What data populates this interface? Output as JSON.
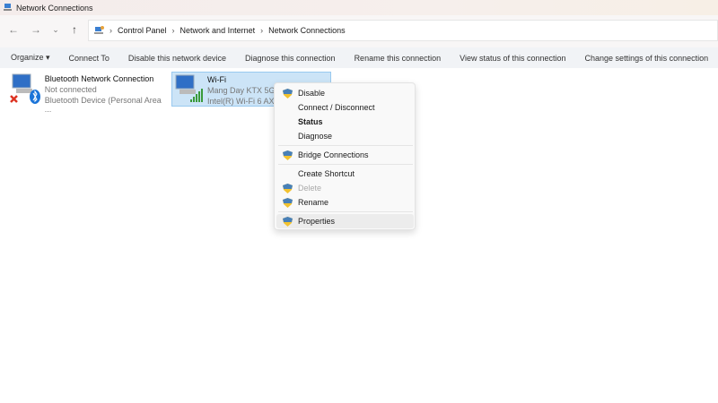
{
  "window": {
    "title": "Network Connections"
  },
  "address": {
    "crumbs": [
      "Control Panel",
      "Network and Internet",
      "Network Connections"
    ]
  },
  "commands": [
    "Organize ▾",
    "Connect To",
    "Disable this network device",
    "Diagnose this connection",
    "Rename this connection",
    "View status of this connection",
    "Change settings of this connection"
  ],
  "connections": [
    {
      "name": "Bluetooth Network Connection",
      "status": "Not connected",
      "device": "Bluetooth Device (Personal Area ..."
    },
    {
      "name": "Wi-Fi",
      "status": "Mang Day KTX 5Gh",
      "device": "Intel(R) Wi-Fi 6 AX2"
    }
  ],
  "context_menu": {
    "items": [
      {
        "label": "Disable",
        "shield": true
      },
      {
        "label": "Connect / Disconnect",
        "shield": false
      },
      {
        "label": "Status",
        "shield": false,
        "bold": true
      },
      {
        "label": "Diagnose",
        "shield": false
      },
      {
        "label": "Bridge Connections",
        "shield": true
      },
      {
        "label": "Create Shortcut",
        "shield": false
      },
      {
        "label": "Delete",
        "shield": true,
        "disabled": true
      },
      {
        "label": "Rename",
        "shield": true
      },
      {
        "label": "Properties",
        "shield": true,
        "highlighted": true
      }
    ]
  },
  "colors": {
    "selection": "#cce4f7",
    "accent": "#0078d4"
  }
}
